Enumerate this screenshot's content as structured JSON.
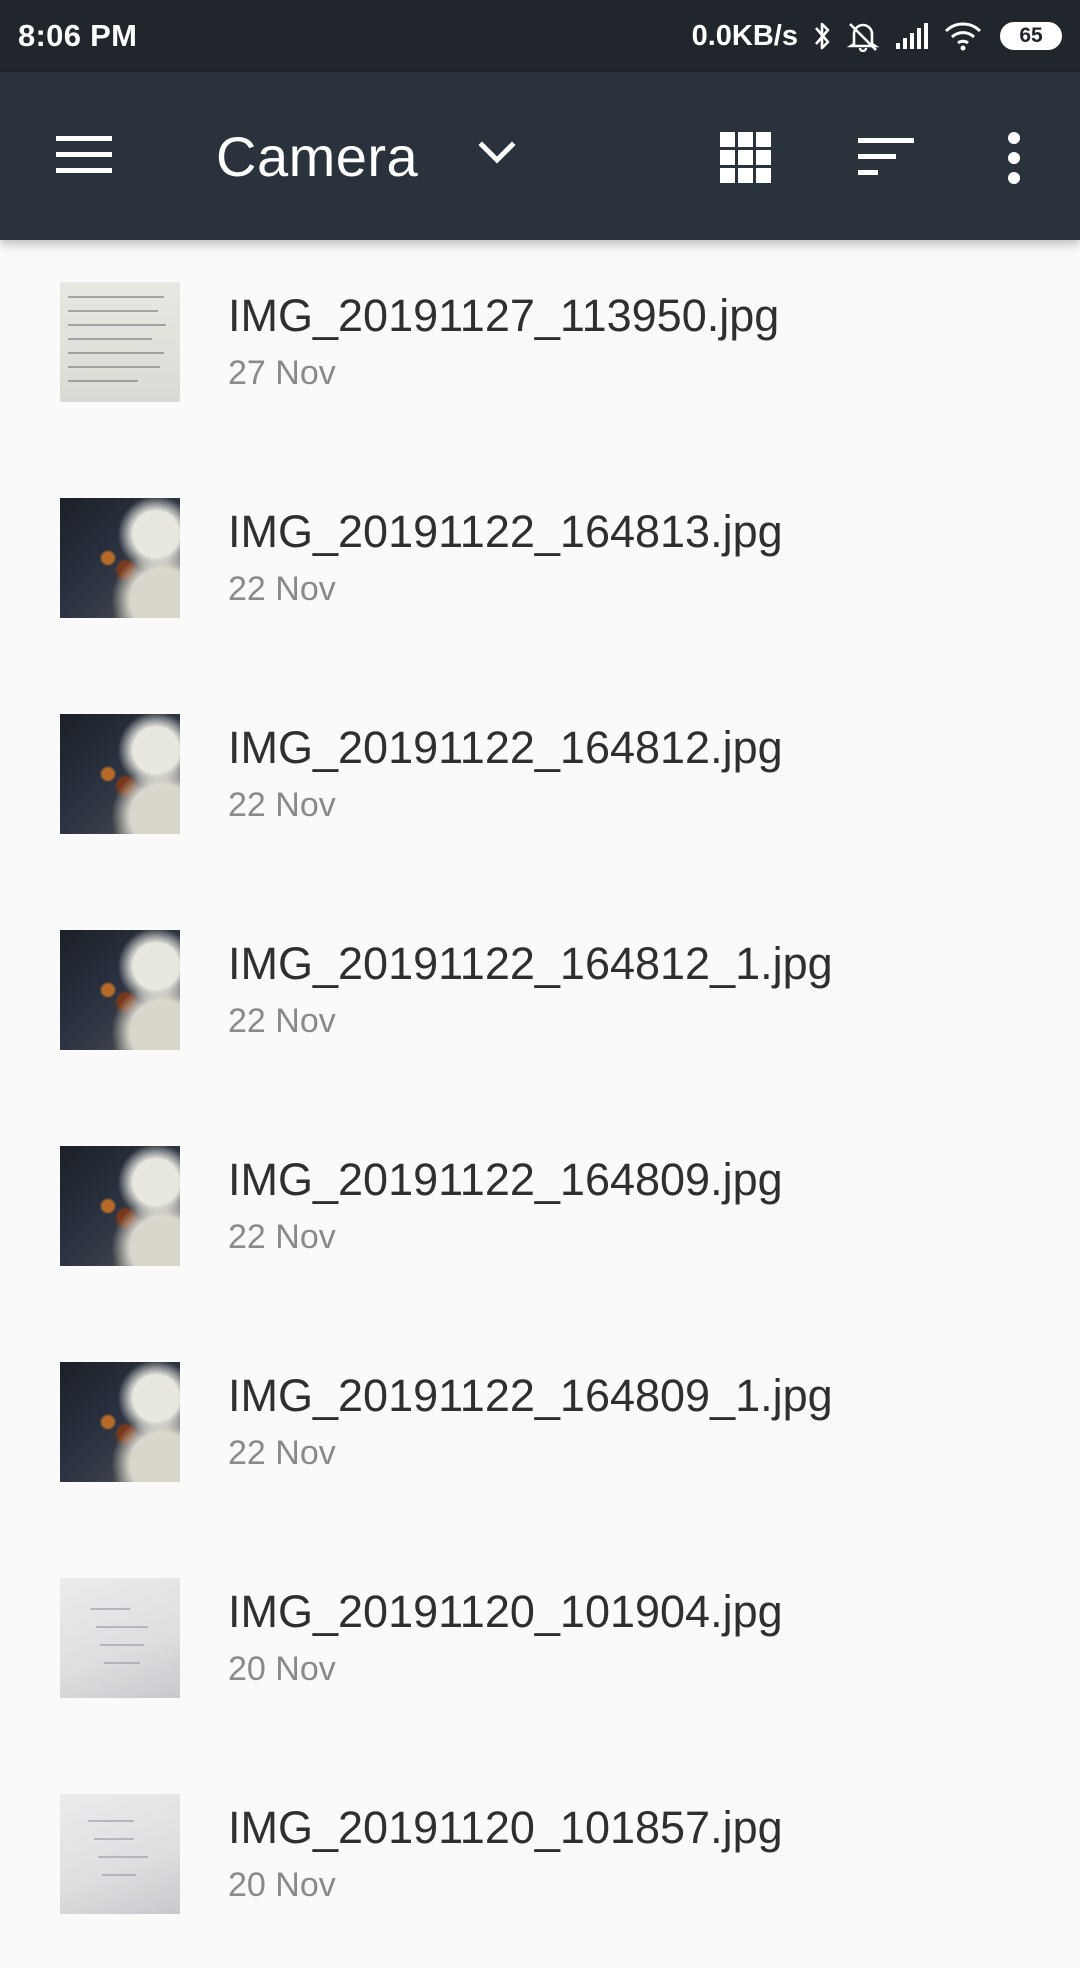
{
  "status_bar": {
    "time": "8:06 PM",
    "speed": "0.0KB/s",
    "battery": "65",
    "icons": [
      "bluetooth-icon",
      "muted-bell-icon",
      "signal-icon",
      "wifi-icon",
      "battery-icon"
    ]
  },
  "toolbar": {
    "title": "Camera",
    "icons": [
      "menu-icon",
      "chevron-down-icon",
      "grid-view-icon",
      "sort-icon",
      "more-vert-icon"
    ],
    "background": "#2a333b"
  },
  "files": [
    {
      "name": "IMG_20191127_113950.jpg",
      "date": "27 Nov",
      "thumb": "doc"
    },
    {
      "name": "IMG_20191122_164813.jpg",
      "date": "22 Nov",
      "thumb": "photo"
    },
    {
      "name": "IMG_20191122_164812.jpg",
      "date": "22 Nov",
      "thumb": "photo"
    },
    {
      "name": "IMG_20191122_164812_1.jpg",
      "date": "22 Nov",
      "thumb": "photo"
    },
    {
      "name": "IMG_20191122_164809.jpg",
      "date": "22 Nov",
      "thumb": "photo"
    },
    {
      "name": "IMG_20191122_164809_1.jpg",
      "date": "22 Nov",
      "thumb": "photo"
    },
    {
      "name": "IMG_20191120_101904.jpg",
      "date": "20 Nov",
      "thumb": "paper"
    },
    {
      "name": "IMG_20191120_101857.jpg",
      "date": "20 Nov",
      "thumb": "paper"
    }
  ]
}
